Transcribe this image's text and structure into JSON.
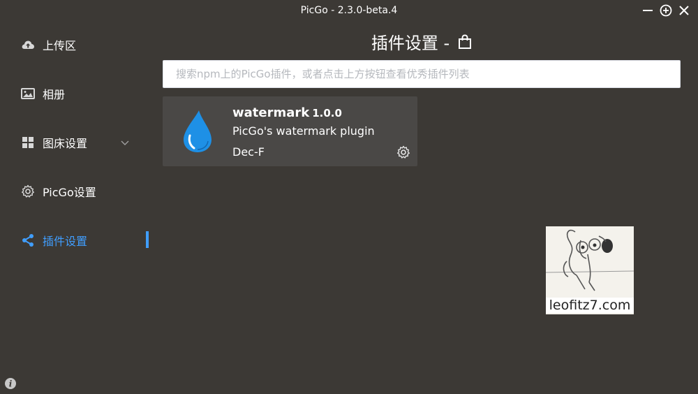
{
  "window": {
    "title": "PicGo - 2.3.0-beta.4"
  },
  "sidebar": {
    "items": [
      {
        "label": "上传区",
        "icon": "cloud-upload-icon"
      },
      {
        "label": "相册",
        "icon": "image-icon"
      },
      {
        "label": "图床设置",
        "icon": "grid-icon"
      },
      {
        "label": "PicGo设置",
        "icon": "gear-icon"
      },
      {
        "label": "插件设置",
        "icon": "share-icon",
        "active": true
      }
    ]
  },
  "main": {
    "title": "插件设置 -",
    "search": {
      "placeholder": "搜索npm上的PicGo插件，或者点击上方按钮查看优秀插件列表",
      "value": ""
    },
    "plugins": [
      {
        "name": "watermark",
        "version": "1.0.0",
        "description": "PicGo's watermark plugin",
        "author": "Dec-F",
        "icon": "water-drop-icon"
      }
    ]
  },
  "watermark_overlay": {
    "text": "leofitz7.com"
  },
  "colors": {
    "background": "#3c3935",
    "accent": "#409eff",
    "card": "#4a4846",
    "logo": "#1e90ff"
  }
}
